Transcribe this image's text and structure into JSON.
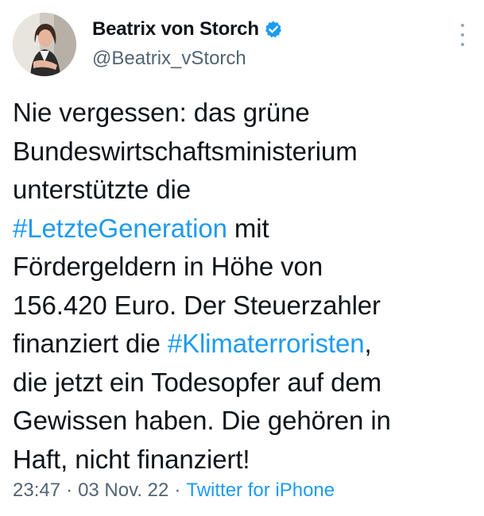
{
  "author": {
    "display_name": "Beatrix von Storch",
    "handle": "@Beatrix_vStorch",
    "verified": true
  },
  "tweet": {
    "lines": [
      [
        {
          "text": "Nie vergessen: das grüne"
        }
      ],
      [
        {
          "text": "Bundeswirtschaftsministerium"
        }
      ],
      [
        {
          "text": "unterstützte die"
        }
      ],
      [
        {
          "text": "#LetzteGeneration",
          "hashtag": true
        },
        {
          "text": " mit"
        }
      ],
      [
        {
          "text": "Fördergeldern in Höhe von"
        }
      ],
      [
        {
          "text": "156.420 Euro. Der Steuerzahler"
        }
      ],
      [
        {
          "text": "finanziert die "
        },
        {
          "text": "#Klimaterroristen",
          "hashtag": true
        },
        {
          "text": ","
        }
      ],
      [
        {
          "text": "die jetzt ein Todesopfer auf dem"
        }
      ],
      [
        {
          "text": "Gewissen haben. Die gehören in"
        }
      ],
      [
        {
          "text": "Haft, nicht finanziert!"
        }
      ]
    ]
  },
  "meta": {
    "time": "23:47",
    "date": "03 Nov. 22",
    "separator": "·",
    "source": "Twitter for iPhone"
  },
  "icons": {
    "verified": "verified-badge-icon",
    "more": "more-options-icon"
  },
  "colors": {
    "link": "#1d9bf0",
    "secondary_text": "#536471",
    "primary_text": "#0f1419"
  }
}
